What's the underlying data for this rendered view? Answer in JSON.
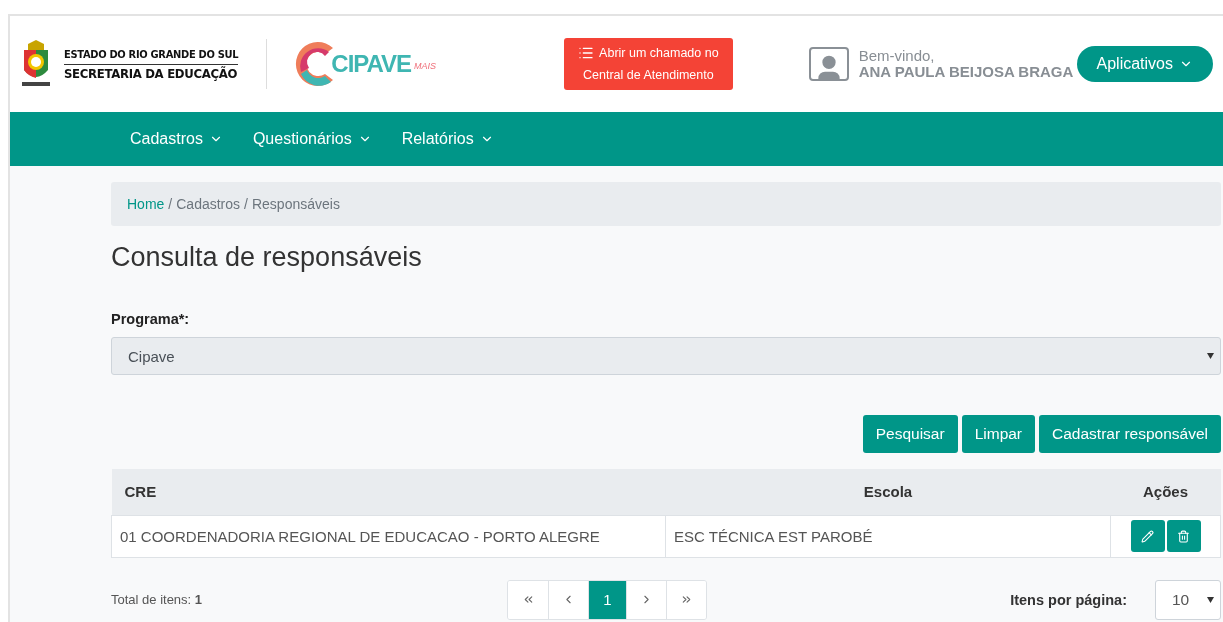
{
  "header": {
    "state_name": "ESTADO DO RIO GRANDE DO SUL",
    "department": "SECRETARIA DA EDUCAÇÃO",
    "logo_text": "CIPAVE",
    "logo_suffix": "MAIS",
    "help_button": {
      "line1": "Abrir um chamado no",
      "line2": "Central de Atendimento"
    },
    "welcome": "Bem-vindo,",
    "user_name": "ANA PAULA BEIJOSA BRAGA",
    "apps_button": "Aplicativos"
  },
  "nav": [
    {
      "label": "Cadastros"
    },
    {
      "label": "Questionários"
    },
    {
      "label": "Relatórios"
    }
  ],
  "breadcrumb": [
    {
      "label": "Home",
      "link": true
    },
    {
      "separator": "/"
    },
    {
      "label": "Cadastros",
      "link": false
    },
    {
      "separator": "/"
    },
    {
      "label": "Responsáveis",
      "link": false
    }
  ],
  "page_title": "Consulta de responsáveis",
  "program_field": {
    "label": "Programa*:",
    "value": "Cipave"
  },
  "buttons": [
    "Pesquisar",
    "Limpar",
    "Cadastrar responsável"
  ],
  "table": {
    "columns": [
      "CRE",
      "Escola",
      "Ações"
    ],
    "rows": [
      {
        "cre": "01 COORDENADORIA REGIONAL DE EDUCACAO - PORTO ALEGRE",
        "escola": "ESC TÉCNICA EST PAROBÉ"
      }
    ]
  },
  "footer": {
    "total_label": "Total de itens:",
    "total_value": "1",
    "pages": [
      {
        "kind": "first"
      },
      {
        "kind": "prev"
      },
      {
        "kind": "page",
        "label": "1",
        "selected": true
      },
      {
        "kind": "next"
      },
      {
        "kind": "last"
      }
    ],
    "page_size_label": "Itens por página:",
    "page_size": "10"
  }
}
